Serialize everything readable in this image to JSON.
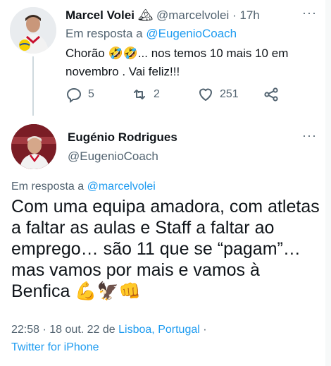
{
  "reply_tweet": {
    "name": "Marcel Volei",
    "badge_emoji": "🏔",
    "handle": "@marcelvolei",
    "separator": "·",
    "time": "17h",
    "reply_prefix": "Em resposta a",
    "reply_to": "@EugenioCoach",
    "text": "Chorão 🤣🤣... nos temos 10 mais 10 em novembro  . Vai feliz!!!",
    "counts": {
      "reply": "5",
      "retweet": "2",
      "like": "251"
    }
  },
  "main_tweet": {
    "name": "Eugénio Rodrigues",
    "handle": "@EugenioCoach",
    "reply_prefix": "Em resposta a",
    "reply_to": "@marcelvolei",
    "text": "Com uma equipa amadora, com atletas a faltar as aulas e Staff a faltar ao emprego… são 11 que se “pagam”… mas vamos por mais e vamos à Benfica 💪🦅👊",
    "time": "22:58",
    "date": "18 out. 22",
    "location_prefix": "de",
    "location": "Lisboa, Portugal",
    "source": "Twitter for iPhone"
  },
  "colors": {
    "accent": "#1d9bf0",
    "secondary_text": "#536471",
    "primary_text": "#0f1419"
  },
  "icons": [
    "more-options-icon",
    "reply-icon",
    "retweet-icon",
    "like-icon",
    "share-icon"
  ]
}
